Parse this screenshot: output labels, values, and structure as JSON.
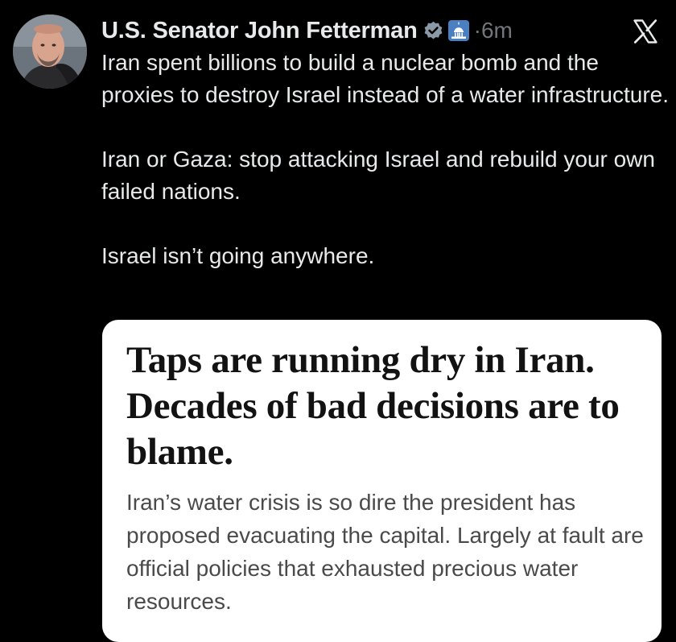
{
  "tweet": {
    "author_name": "U.S. Senator John Fetterman",
    "time_separator": "·",
    "timestamp": "6m",
    "paragraphs": [
      "Iran spent billions to build a nuclear bomb and the proxies to destroy Israel instead of a water infrastructure.",
      "Iran or Gaza: stop attacking Israel and rebuild your own failed nations.",
      "Israel isn’t going anywhere."
    ]
  },
  "article_card": {
    "headline": "Taps are running dry in Iran. Decades of bad decisions are to blame.",
    "summary": "Iran’s water crisis is so dire the president has proposed evacuating the capital. Largely at fault are official policies that exhausted precious water resources."
  },
  "icons": {
    "verified": "verified-badge-icon",
    "government": "capitol-building-icon",
    "platform": "x-logo-icon"
  },
  "colors": {
    "background": "#000000",
    "text": "#e7e9ea",
    "muted": "#71767b",
    "card_background": "#ffffff",
    "gov_badge": "#4a7fc1"
  }
}
